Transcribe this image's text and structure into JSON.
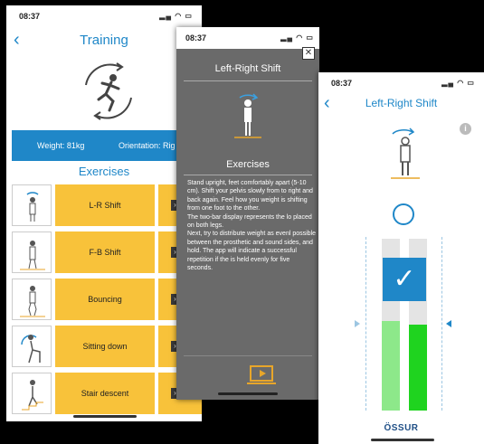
{
  "training_screen": {
    "time": "08:37",
    "title": "Training",
    "weight": "Weight: 81kg",
    "orientation": "Orientation: Rig",
    "exercises_heading": "Exercises",
    "exercises": [
      {
        "label": "L-R Shift"
      },
      {
        "label": "F-B Shift"
      },
      {
        "label": "Bouncing"
      },
      {
        "label": "Sitting down"
      },
      {
        "label": "Stair descent"
      }
    ]
  },
  "detail_screen": {
    "time": "08:37",
    "title": "Left-Right Shift",
    "close": "✕",
    "exercises_heading": "Exercises",
    "description": "Stand upright, feet comfortably apart (5-10 cm). Shift your pelvis slowly from to right and back again. Feel how you weight is shifting from one foot to the other.\nThe two-bar display represents the lo placed on both legs.\nNext, try to distribute weight as evenl possible between the prosthetic and sound sides, and hold. The app will indicate a successful repetition if the is held evenly for five seconds."
  },
  "balance_screen": {
    "time": "08:37",
    "title": "Left-Right Shift",
    "info": "i",
    "check": "✓",
    "left_fill": 0.52,
    "right_fill": 0.5,
    "colors": {
      "left_bar": "#8de88a",
      "right_bar": "#1fd31f",
      "accent": "#1f87c8"
    },
    "logo": "ÖSSUR"
  }
}
